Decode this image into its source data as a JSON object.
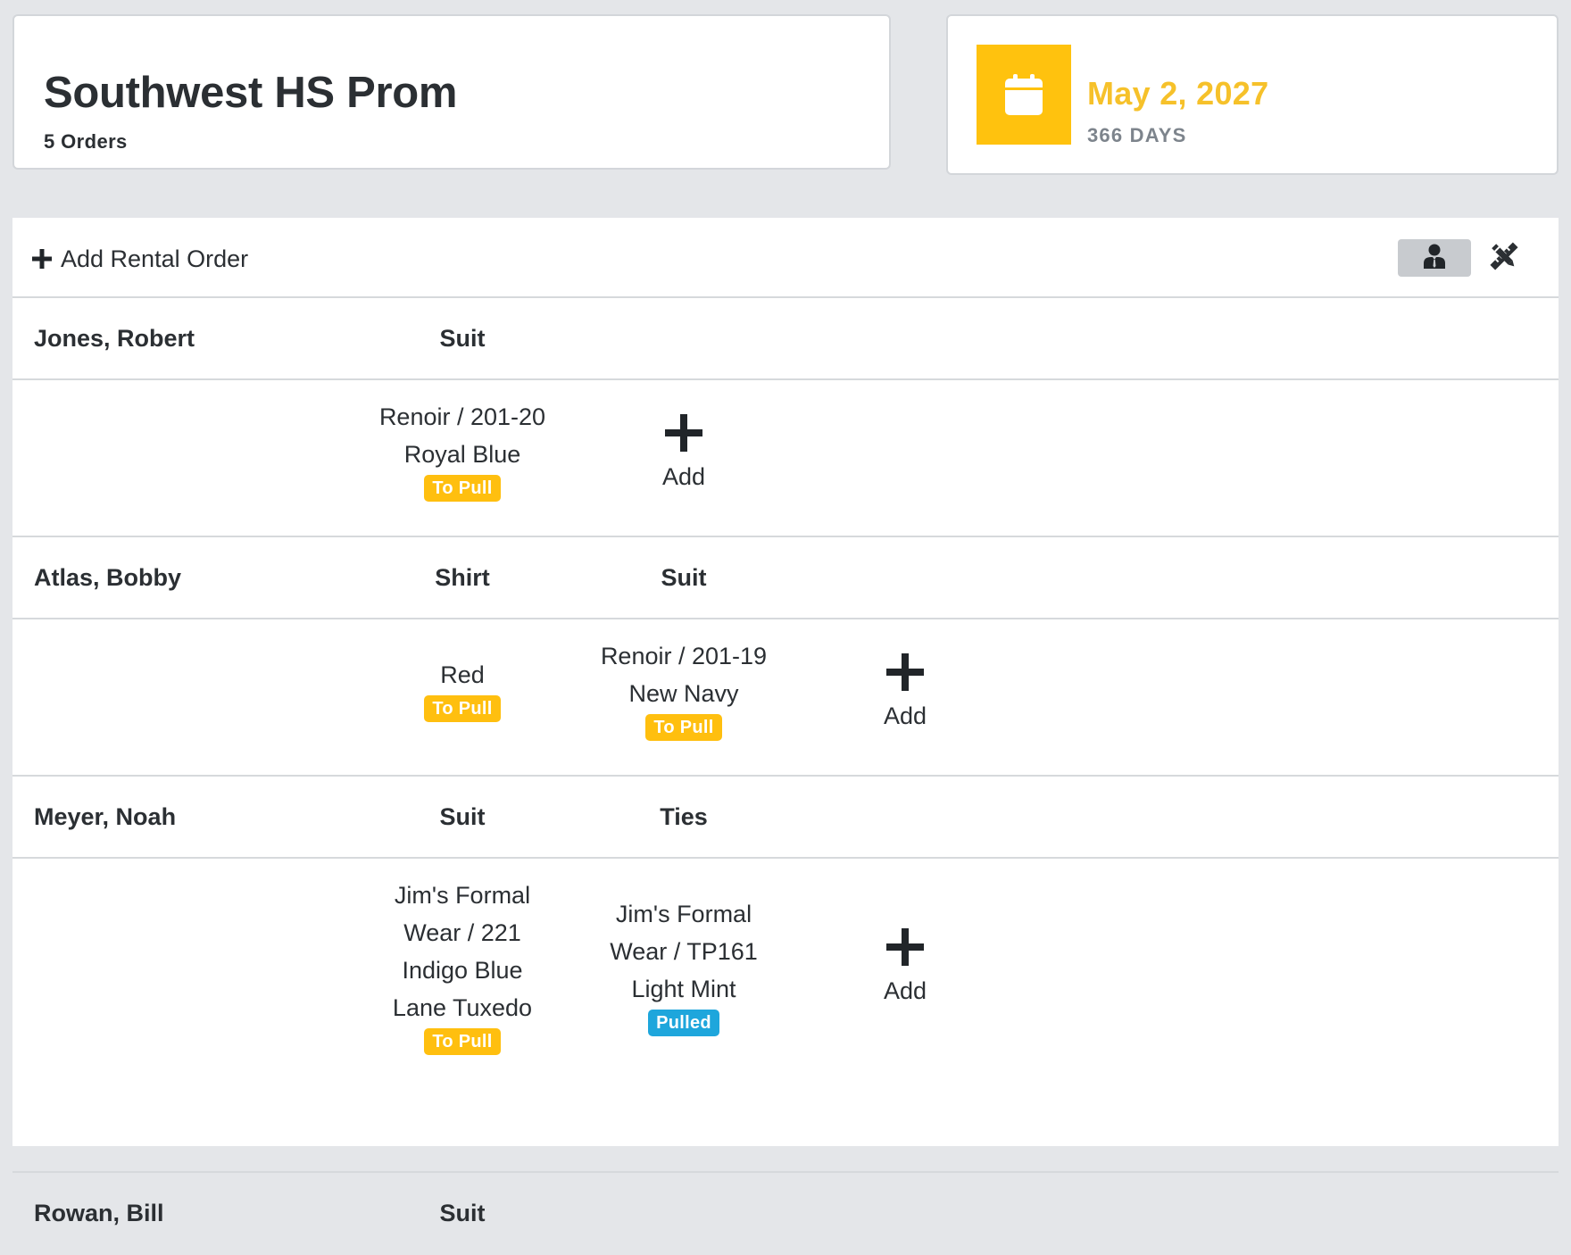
{
  "event": {
    "title": "Southwest HS Prom",
    "orders_label": "5 Orders"
  },
  "date_card": {
    "date": "May 2, 2027",
    "countdown": "366 DAYS",
    "accent": "#ffc20e",
    "icon": "calendar-icon"
  },
  "toolbar": {
    "add_order_label": "Add Rental Order",
    "view_icon": "customer-view-icon",
    "edit_icon": "pencil-ruler-icon"
  },
  "orders": [
    {
      "name": "Jones, Robert",
      "categories": [
        "Suit"
      ],
      "items": [
        {
          "lines": [
            "Renoir / 201-20",
            "Royal Blue"
          ],
          "status": "To Pull"
        }
      ],
      "add_label": "Add"
    },
    {
      "name": "Atlas, Bobby",
      "categories": [
        "Shirt",
        "Suit"
      ],
      "items": [
        {
          "lines": [
            "Red"
          ],
          "status": "To Pull"
        },
        {
          "lines": [
            "Renoir / 201-19",
            "New Navy"
          ],
          "status": "To Pull"
        }
      ],
      "add_label": "Add"
    },
    {
      "name": "Meyer, Noah",
      "categories": [
        "Suit",
        "Ties"
      ],
      "items": [
        {
          "lines": [
            "Jim's Formal",
            "Wear / 221",
            "Indigo Blue",
            "Lane Tuxedo"
          ],
          "status": "To Pull"
        },
        {
          "lines": [
            "Jim's Formal",
            "Wear / TP161",
            "Light Mint"
          ],
          "status": "Pulled"
        }
      ],
      "add_label": "Add"
    },
    {
      "name": "Rowan, Bill",
      "categories": [
        "Suit"
      ]
    }
  ],
  "status_colors": {
    "To Pull": "#ffbf0f",
    "Pulled": "#1ea6dc"
  }
}
